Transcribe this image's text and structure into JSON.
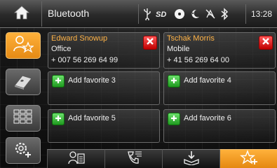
{
  "header": {
    "title": "Bluetooth",
    "clock": "13:28",
    "status_icons": [
      "usb-icon",
      "sd-card-icon",
      "disc-icon",
      "night-mode-icon",
      "no-signal-icon",
      "bluetooth-icon"
    ]
  },
  "sidebar": {
    "items": [
      {
        "name": "favorites-contacts",
        "icon": "person-star-icon",
        "active": true
      },
      {
        "name": "phonebook",
        "icon": "phonebook-icon",
        "active": false
      },
      {
        "name": "keypad",
        "icon": "keypad-icon",
        "active": false
      },
      {
        "name": "settings",
        "icon": "gear-plus-icon",
        "active": false
      }
    ]
  },
  "favorites": {
    "contacts": [
      {
        "name": "Edward Snowup",
        "type": "Office",
        "number": "+ 007 56 269 64 99"
      },
      {
        "name": "Tschak Morris",
        "type": "Mobile",
        "number": "+ 41 56 269 64 00"
      }
    ],
    "empty_slots": [
      {
        "label": "Add favorite 3"
      },
      {
        "label": "Add favorite 4"
      },
      {
        "label": "Add favorite 5"
      },
      {
        "label": "Add favorite 6"
      }
    ]
  },
  "bottom_tabs": [
    {
      "name": "contacts",
      "icon": "contact-card-icon",
      "active": false
    },
    {
      "name": "call-log",
      "icon": "call-log-icon",
      "active": false
    },
    {
      "name": "messages",
      "icon": "book-download-icon",
      "active": false
    },
    {
      "name": "favorites",
      "icon": "star-plus-icon",
      "active": true
    }
  ],
  "colors": {
    "accent": "#f5a02c",
    "contact_name": "#ffb347",
    "delete": "#d41414",
    "add": "#2eb82e"
  }
}
